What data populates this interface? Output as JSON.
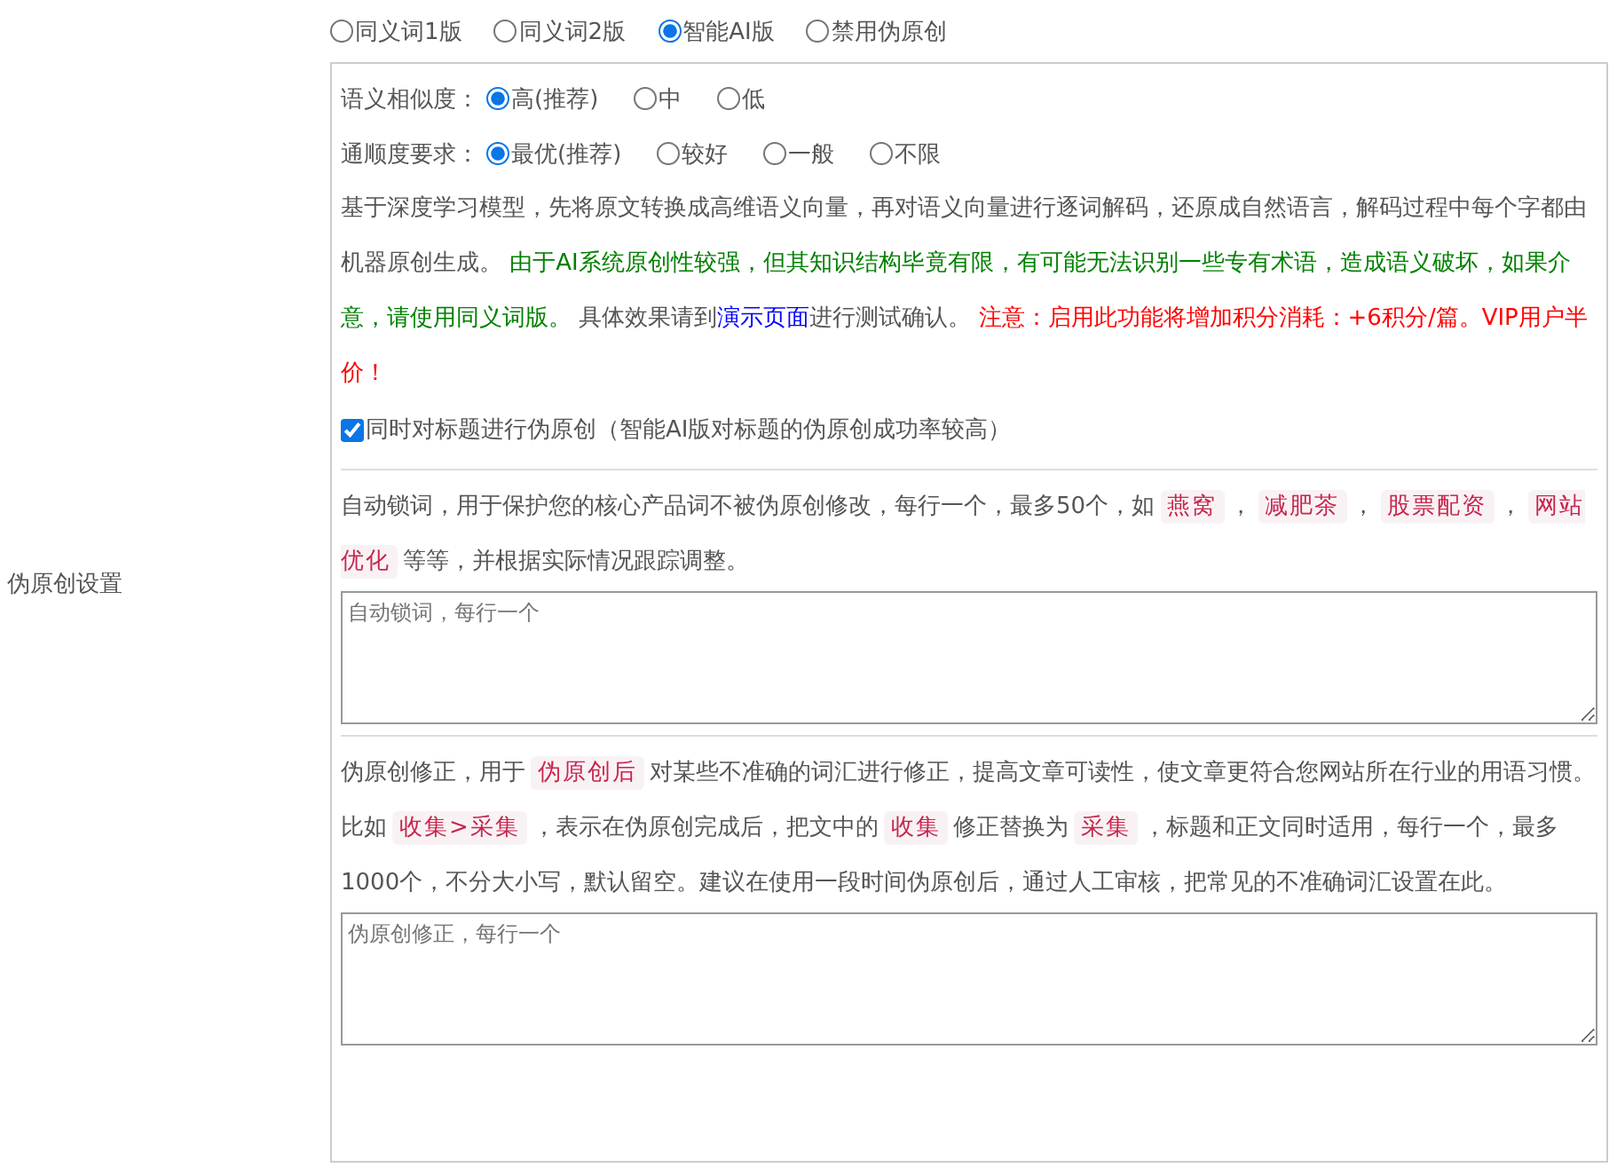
{
  "section_label": "伪原创设置",
  "modes": [
    {
      "label": "同义词1版",
      "selected": false
    },
    {
      "label": "同义词2版",
      "selected": false
    },
    {
      "label": "智能AI版",
      "selected": true
    },
    {
      "label": "禁用伪原创",
      "selected": false
    }
  ],
  "options": [
    {
      "label": "语义相似度：",
      "choices": [
        {
          "label": "高(推荐)",
          "selected": true
        },
        {
          "label": "中",
          "selected": false
        },
        {
          "label": "低",
          "selected": false
        }
      ]
    },
    {
      "label": "通顺度要求：",
      "choices": [
        {
          "label": "最优(推荐)",
          "selected": true
        },
        {
          "label": "较好",
          "selected": false
        },
        {
          "label": "一般",
          "selected": false
        },
        {
          "label": "不限",
          "selected": false
        }
      ]
    }
  ],
  "description": [
    {
      "kind": "text",
      "text": "基于深度学习模型，先将原文转换成高维语义向量，再对语义向量进行逐词解码，还原成自然语言，解码过程中每个字都由机器原创生成。 "
    },
    {
      "kind": "notice",
      "text": "由于AI系统原创性较强，但其知识结构毕竟有限，有可能无法识别一些专有术语，造成语义破坏，如果介意，请使用同义词版。"
    },
    {
      "kind": "text",
      "text": " 具体效果请到"
    },
    {
      "kind": "link",
      "text": "演示页面"
    },
    {
      "kind": "text",
      "text": "进行测试确认。 "
    },
    {
      "kind": "warning",
      "text": "注意：启用此功能将增加积分消耗：+6积分/篇。VIP用户半价！"
    }
  ],
  "title_option": {
    "label": "同时对标题进行伪原创（智能AI版对标题的伪原创成功率较高）",
    "checked": true
  },
  "lock_words": {
    "help": [
      {
        "kind": "text",
        "text": "自动锁词，用于保护您的核心产品词不被伪原创修改，每行一个，最多50个，如"
      },
      {
        "kind": "code",
        "text": "燕窝"
      },
      {
        "kind": "text",
        "text": "，"
      },
      {
        "kind": "code",
        "text": "减肥茶"
      },
      {
        "kind": "text",
        "text": "，"
      },
      {
        "kind": "code",
        "text": "股票配资"
      },
      {
        "kind": "text",
        "text": "，"
      },
      {
        "kind": "code",
        "text": "网站优化"
      },
      {
        "kind": "text",
        "text": "等等，并根据实际情况跟踪调整。"
      }
    ],
    "placeholder": "自动锁词，每行一个"
  },
  "corrections": {
    "help": [
      {
        "kind": "text",
        "text": "伪原创修正，用于"
      },
      {
        "kind": "code",
        "text": "伪原创后"
      },
      {
        "kind": "text",
        "text": "对某些不准确的词汇进行修正，提高文章可读性，使文章更符合您网站所在行业的用语习惯。比如"
      },
      {
        "kind": "code",
        "text": "收集>采集"
      },
      {
        "kind": "text",
        "text": "，表示在伪原创完成后，把文中的"
      },
      {
        "kind": "code",
        "text": "收集"
      },
      {
        "kind": "text",
        "text": "修正替换为"
      },
      {
        "kind": "code",
        "text": "采集"
      },
      {
        "kind": "text",
        "text": "，标题和正文同时适用，每行一个，最多1000个，不分大小写，默认留空。建议在使用一段时间伪原创后，通过人工审核，把常见的不准确词汇设置在此。"
      }
    ],
    "placeholder": "伪原创修正，每行一个"
  }
}
